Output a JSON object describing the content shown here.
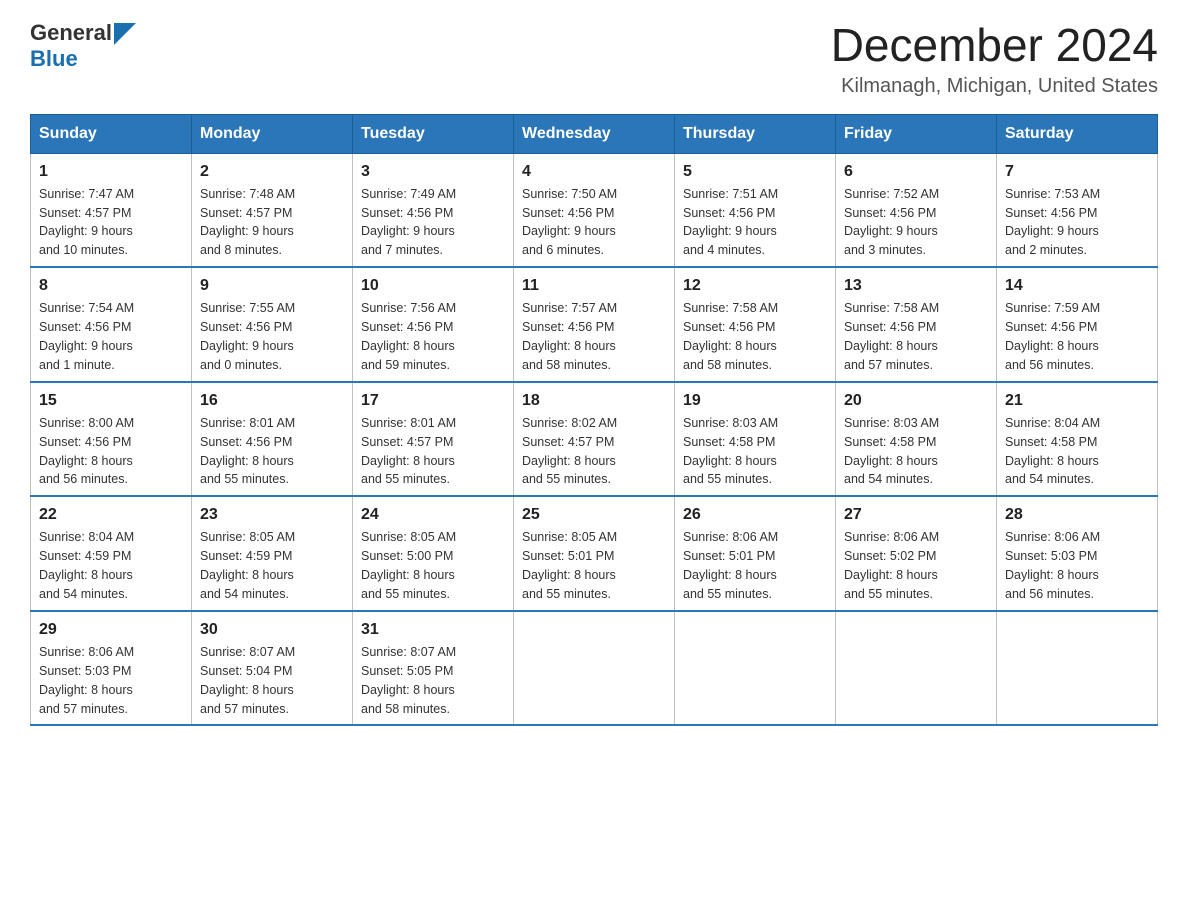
{
  "logo": {
    "text_general": "General",
    "text_blue": "Blue"
  },
  "header": {
    "title": "December 2024",
    "subtitle": "Kilmanagh, Michigan, United States"
  },
  "days_of_week": [
    "Sunday",
    "Monday",
    "Tuesday",
    "Wednesday",
    "Thursday",
    "Friday",
    "Saturday"
  ],
  "weeks": [
    [
      {
        "day": "1",
        "sunrise": "7:47 AM",
        "sunset": "4:57 PM",
        "daylight": "9 hours and 10 minutes."
      },
      {
        "day": "2",
        "sunrise": "7:48 AM",
        "sunset": "4:57 PM",
        "daylight": "9 hours and 8 minutes."
      },
      {
        "day": "3",
        "sunrise": "7:49 AM",
        "sunset": "4:56 PM",
        "daylight": "9 hours and 7 minutes."
      },
      {
        "day": "4",
        "sunrise": "7:50 AM",
        "sunset": "4:56 PM",
        "daylight": "9 hours and 6 minutes."
      },
      {
        "day": "5",
        "sunrise": "7:51 AM",
        "sunset": "4:56 PM",
        "daylight": "9 hours and 4 minutes."
      },
      {
        "day": "6",
        "sunrise": "7:52 AM",
        "sunset": "4:56 PM",
        "daylight": "9 hours and 3 minutes."
      },
      {
        "day": "7",
        "sunrise": "7:53 AM",
        "sunset": "4:56 PM",
        "daylight": "9 hours and 2 minutes."
      }
    ],
    [
      {
        "day": "8",
        "sunrise": "7:54 AM",
        "sunset": "4:56 PM",
        "daylight": "9 hours and 1 minute."
      },
      {
        "day": "9",
        "sunrise": "7:55 AM",
        "sunset": "4:56 PM",
        "daylight": "9 hours and 0 minutes."
      },
      {
        "day": "10",
        "sunrise": "7:56 AM",
        "sunset": "4:56 PM",
        "daylight": "8 hours and 59 minutes."
      },
      {
        "day": "11",
        "sunrise": "7:57 AM",
        "sunset": "4:56 PM",
        "daylight": "8 hours and 58 minutes."
      },
      {
        "day": "12",
        "sunrise": "7:58 AM",
        "sunset": "4:56 PM",
        "daylight": "8 hours and 58 minutes."
      },
      {
        "day": "13",
        "sunrise": "7:58 AM",
        "sunset": "4:56 PM",
        "daylight": "8 hours and 57 minutes."
      },
      {
        "day": "14",
        "sunrise": "7:59 AM",
        "sunset": "4:56 PM",
        "daylight": "8 hours and 56 minutes."
      }
    ],
    [
      {
        "day": "15",
        "sunrise": "8:00 AM",
        "sunset": "4:56 PM",
        "daylight": "8 hours and 56 minutes."
      },
      {
        "day": "16",
        "sunrise": "8:01 AM",
        "sunset": "4:56 PM",
        "daylight": "8 hours and 55 minutes."
      },
      {
        "day": "17",
        "sunrise": "8:01 AM",
        "sunset": "4:57 PM",
        "daylight": "8 hours and 55 minutes."
      },
      {
        "day": "18",
        "sunrise": "8:02 AM",
        "sunset": "4:57 PM",
        "daylight": "8 hours and 55 minutes."
      },
      {
        "day": "19",
        "sunrise": "8:03 AM",
        "sunset": "4:58 PM",
        "daylight": "8 hours and 55 minutes."
      },
      {
        "day": "20",
        "sunrise": "8:03 AM",
        "sunset": "4:58 PM",
        "daylight": "8 hours and 54 minutes."
      },
      {
        "day": "21",
        "sunrise": "8:04 AM",
        "sunset": "4:58 PM",
        "daylight": "8 hours and 54 minutes."
      }
    ],
    [
      {
        "day": "22",
        "sunrise": "8:04 AM",
        "sunset": "4:59 PM",
        "daylight": "8 hours and 54 minutes."
      },
      {
        "day": "23",
        "sunrise": "8:05 AM",
        "sunset": "4:59 PM",
        "daylight": "8 hours and 54 minutes."
      },
      {
        "day": "24",
        "sunrise": "8:05 AM",
        "sunset": "5:00 PM",
        "daylight": "8 hours and 55 minutes."
      },
      {
        "day": "25",
        "sunrise": "8:05 AM",
        "sunset": "5:01 PM",
        "daylight": "8 hours and 55 minutes."
      },
      {
        "day": "26",
        "sunrise": "8:06 AM",
        "sunset": "5:01 PM",
        "daylight": "8 hours and 55 minutes."
      },
      {
        "day": "27",
        "sunrise": "8:06 AM",
        "sunset": "5:02 PM",
        "daylight": "8 hours and 55 minutes."
      },
      {
        "day": "28",
        "sunrise": "8:06 AM",
        "sunset": "5:03 PM",
        "daylight": "8 hours and 56 minutes."
      }
    ],
    [
      {
        "day": "29",
        "sunrise": "8:06 AM",
        "sunset": "5:03 PM",
        "daylight": "8 hours and 57 minutes."
      },
      {
        "day": "30",
        "sunrise": "8:07 AM",
        "sunset": "5:04 PM",
        "daylight": "8 hours and 57 minutes."
      },
      {
        "day": "31",
        "sunrise": "8:07 AM",
        "sunset": "5:05 PM",
        "daylight": "8 hours and 58 minutes."
      },
      null,
      null,
      null,
      null
    ]
  ],
  "labels": {
    "sunrise": "Sunrise:",
    "sunset": "Sunset:",
    "daylight": "Daylight:"
  }
}
